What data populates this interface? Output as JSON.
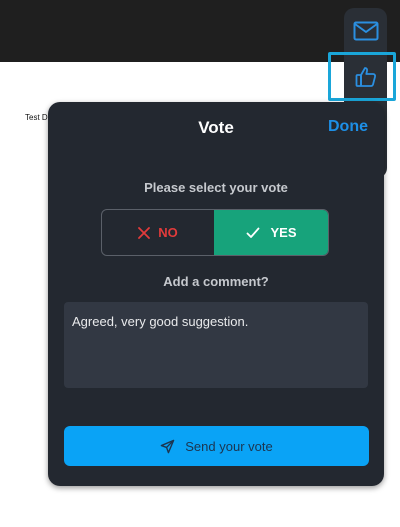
{
  "document": {
    "text": "Test D"
  },
  "side_toolbar": {
    "items": [
      {
        "icon": "mail-icon"
      },
      {
        "icon": "thumbs-up-icon",
        "highlighted": true
      }
    ]
  },
  "vote_panel": {
    "title": "Vote",
    "done_label": "Done",
    "select_prompt": "Please select your vote",
    "options": [
      {
        "label": "NO",
        "icon": "close-icon",
        "color": "#e23b3b"
      },
      {
        "label": "YES",
        "icon": "checkmark-icon",
        "selected": true,
        "color": "#17a37b"
      }
    ],
    "comment_prompt": "Add a comment?",
    "comment_value": "Agreed, very good suggestion.",
    "send_label": "Send your vote"
  },
  "colors": {
    "accent": "#1d8fe6",
    "send_button": "#0aa3f6",
    "highlight_outline": "#1aa6d9",
    "panel_bg": "#232830"
  }
}
